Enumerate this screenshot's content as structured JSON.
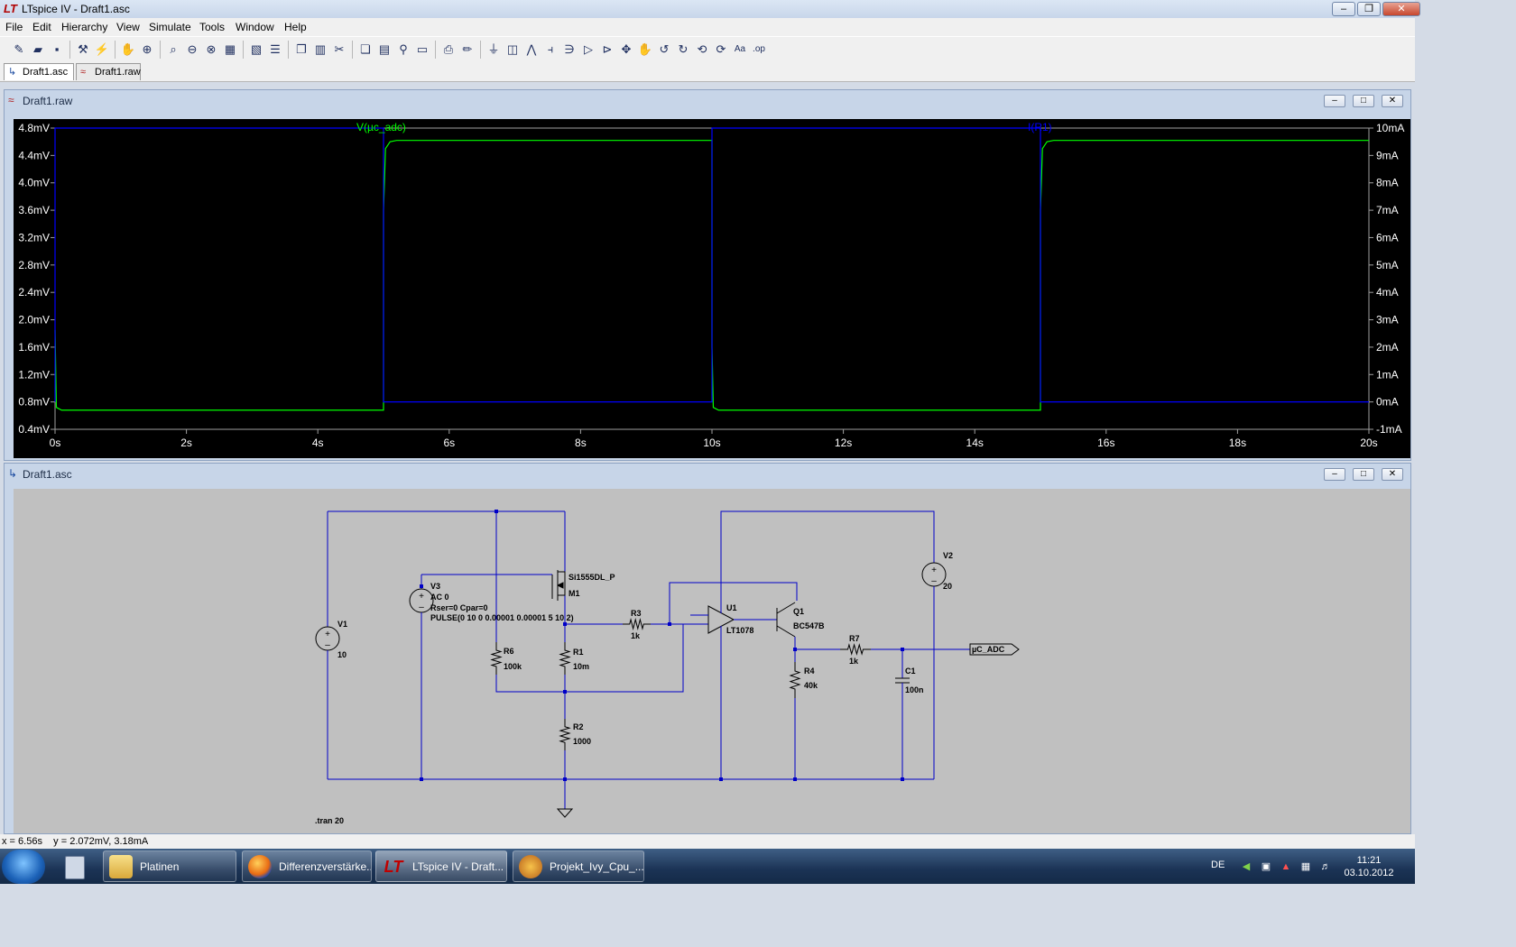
{
  "window": {
    "title": "LTspice IV - Draft1.asc"
  },
  "menu": [
    "File",
    "Edit",
    "Hierarchy",
    "View",
    "Simulate",
    "Tools",
    "Window",
    "Help"
  ],
  "toolbar_icons": [
    "new-schematic-icon",
    "open-icon",
    "save-icon",
    "control-panel-icon",
    "run-icon",
    "halt-icon",
    "zoom-in-icon",
    "zoom-area-icon",
    "zoom-out-icon",
    "zoom-cancel-icon",
    "autorange-icon",
    "pick-visible-traces-icon",
    "tile-horizontal-icon",
    "cascade-icon",
    "tile-vertical-icon",
    "cut-icon",
    "copy-icon",
    "paste-icon",
    "find-icon",
    "print-setup-icon",
    "print-icon",
    "draw-wire-icon",
    "ground-icon",
    "label-net-icon",
    "resistor-icon",
    "capacitor-icon",
    "inductor-icon",
    "diode-icon",
    "component-icon",
    "move-icon",
    "drag-icon",
    "undo-icon",
    "redo-icon",
    "rotate-icon",
    "mirror-icon",
    "text-icon",
    "spice-directive-icon"
  ],
  "tabs": [
    {
      "label": "Draft1.asc",
      "active": true
    },
    {
      "label": "Draft1.raw",
      "active": false
    }
  ],
  "plot_window": {
    "title": "Draft1.raw"
  },
  "schematic_window": {
    "title": "Draft1.asc"
  },
  "chart_data": {
    "type": "line",
    "x_ticks": [
      "0s",
      "2s",
      "4s",
      "6s",
      "8s",
      "10s",
      "12s",
      "14s",
      "16s",
      "18s",
      "20s"
    ],
    "xlim": [
      0,
      20
    ],
    "y_left_ticks": [
      "4.8mV",
      "4.4mV",
      "4.0mV",
      "3.6mV",
      "3.2mV",
      "2.8mV",
      "2.4mV",
      "2.0mV",
      "1.6mV",
      "1.2mV",
      "0.8mV",
      "0.4mV"
    ],
    "ylim_left": [
      0.4,
      4.8
    ],
    "y_right_ticks": [
      "10mA",
      "9mA",
      "8mA",
      "7mA",
      "6mA",
      "5mA",
      "4mA",
      "3mA",
      "2mA",
      "1mA",
      "0mA",
      "-1mA"
    ],
    "ylim_right": [
      -1,
      10
    ],
    "series": [
      {
        "name": "V(µc_adc)",
        "axis": "left",
        "color": "#00ff00",
        "x": [
          0,
          0.02,
          0.1,
          5.0,
          5.0,
          5.03,
          5.1,
          5.2,
          10.0,
          10.0,
          10.02,
          10.1,
          15.0,
          15.0,
          15.03,
          15.1,
          15.2,
          20.0
        ],
        "y": [
          1.85,
          0.72,
          0.68,
          0.68,
          3.6,
          4.5,
          4.6,
          4.62,
          4.62,
          1.6,
          0.72,
          0.68,
          0.68,
          3.6,
          4.5,
          4.6,
          4.62,
          4.62
        ]
      },
      {
        "name": "I(R1)",
        "axis": "right",
        "color": "#0000ff",
        "x": [
          0,
          0,
          5.0,
          5.0,
          10.0,
          10.0,
          15.0,
          15.0,
          20.0
        ],
        "y": [
          0,
          10,
          10,
          0,
          0,
          10,
          10,
          0,
          0
        ]
      }
    ]
  },
  "schematic": {
    "labels": {
      "V1": "V1",
      "V1_val": "10",
      "V3": "V3",
      "V3_ac": "AC 0",
      "V3_rser": "Rser=0 Cpar=0",
      "V3_pulse": "PULSE(0 10 0 0.00001 0.00001 5 10 2)",
      "M1_model": "Si1555DL_P",
      "M1": "M1",
      "R6": "R6",
      "R6_val": "100k",
      "R1": "R1",
      "R1_val": "10m",
      "R2": "R2",
      "R2_val": "1000",
      "R3": "R3",
      "R3_val": "1k",
      "U1": "U1",
      "U1_model": "LT1078",
      "Q1": "Q1",
      "Q1_model": "BC547B",
      "R4": "R4",
      "R4_val": "40k",
      "R7": "R7",
      "R7_val": "1k",
      "C1": "C1",
      "C1_val": "100n",
      "V2": "V2",
      "V2_val": "20",
      "net_label": "µC_ADC",
      "directive": ".tran 20"
    }
  },
  "status": {
    "text": "x = 6.56s    y = 2.072mV, 3.18mA"
  },
  "taskbar": {
    "items": [
      {
        "label": "Platinen",
        "icon": "folder-icon",
        "active": false
      },
      {
        "label": "Differenzverstärke...",
        "icon": "firefox-icon",
        "active": false
      },
      {
        "label": "LTspice IV - Draft...",
        "icon": "ltspice-icon",
        "active": true
      },
      {
        "label": "Projekt_Ivy_Cpu_...",
        "icon": "app-icon",
        "active": false
      }
    ],
    "language": "DE",
    "time": "11:21",
    "date": "03.10.2012"
  }
}
